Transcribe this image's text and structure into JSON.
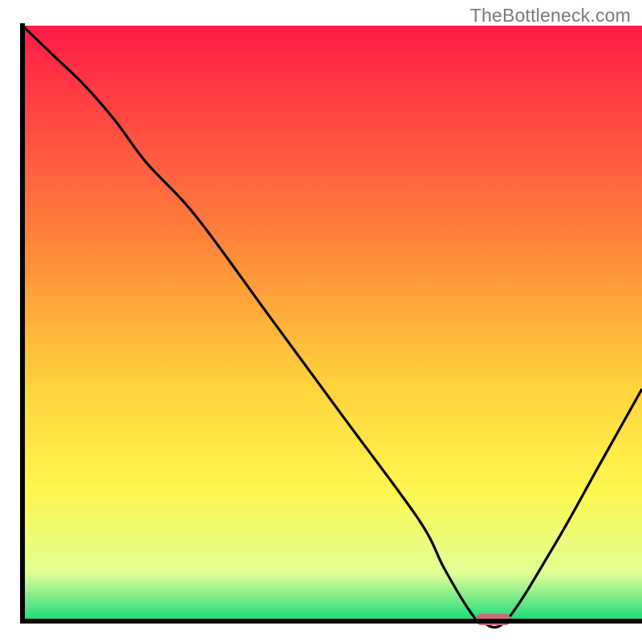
{
  "watermark": "TheBottleneck.com",
  "chart_data": {
    "type": "line",
    "title": "",
    "xlabel": "",
    "ylabel": "",
    "xlim": [
      0,
      100
    ],
    "ylim": [
      0,
      100
    ],
    "legend": false,
    "grid": false,
    "background": {
      "gradient_stops": [
        {
          "offset": 0,
          "color": "#ff1b46"
        },
        {
          "offset": 35,
          "color": "#ff803b"
        },
        {
          "offset": 60,
          "color": "#ffd23b"
        },
        {
          "offset": 78,
          "color": "#fff74f"
        },
        {
          "offset": 92,
          "color": "#e1ff95"
        },
        {
          "offset": 98,
          "color": "#49e383"
        },
        {
          "offset": 100,
          "color": "#14db7a"
        }
      ]
    },
    "series": [
      {
        "name": "bottleneck-curve",
        "x": [
          0,
          5,
          10,
          15,
          20,
          28,
          40,
          52,
          64,
          68,
          72,
          74,
          78,
          86,
          93,
          100
        ],
        "y": [
          100,
          95,
          90,
          84,
          77,
          68,
          51,
          34,
          17,
          9,
          2,
          0,
          0,
          13,
          26,
          39
        ]
      }
    ],
    "markers": [
      {
        "name": "optimal-spot",
        "x": 76,
        "y": 0,
        "shape": "pill",
        "color": "#d0687d"
      }
    ]
  }
}
